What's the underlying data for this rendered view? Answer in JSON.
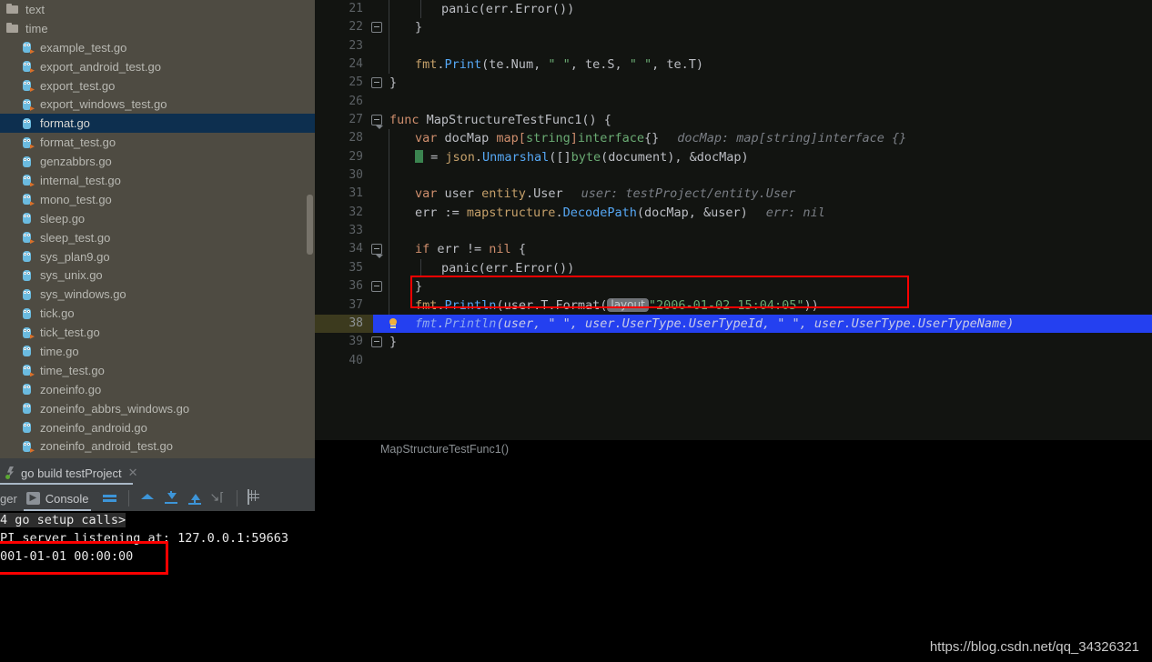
{
  "sidebar": {
    "name": "project-file-tree",
    "items": [
      {
        "label": "text",
        "icon": "folder-icon",
        "kind": "folder",
        "depth": 0,
        "selected": false
      },
      {
        "label": "time",
        "icon": "folder-icon",
        "kind": "folder",
        "depth": 0,
        "selected": false
      },
      {
        "label": "example_test.go",
        "icon": "go-test-file-icon",
        "kind": "gotest",
        "depth": 1,
        "selected": false
      },
      {
        "label": "export_android_test.go",
        "icon": "go-test-file-icon",
        "kind": "gotest",
        "depth": 1,
        "selected": false
      },
      {
        "label": "export_test.go",
        "icon": "go-test-file-icon",
        "kind": "gotest",
        "depth": 1,
        "selected": false
      },
      {
        "label": "export_windows_test.go",
        "icon": "go-test-file-icon",
        "kind": "gotest",
        "depth": 1,
        "selected": false
      },
      {
        "label": "format.go",
        "icon": "go-file-icon",
        "kind": "go",
        "depth": 1,
        "selected": true
      },
      {
        "label": "format_test.go",
        "icon": "go-test-file-icon",
        "kind": "gotest",
        "depth": 1,
        "selected": false
      },
      {
        "label": "genzabbrs.go",
        "icon": "go-file-icon",
        "kind": "go",
        "depth": 1,
        "selected": false
      },
      {
        "label": "internal_test.go",
        "icon": "go-test-file-icon",
        "kind": "gotest",
        "depth": 1,
        "selected": false
      },
      {
        "label": "mono_test.go",
        "icon": "go-test-file-icon",
        "kind": "gotest",
        "depth": 1,
        "selected": false
      },
      {
        "label": "sleep.go",
        "icon": "go-file-icon",
        "kind": "go",
        "depth": 1,
        "selected": false
      },
      {
        "label": "sleep_test.go",
        "icon": "go-test-file-icon",
        "kind": "gotest",
        "depth": 1,
        "selected": false
      },
      {
        "label": "sys_plan9.go",
        "icon": "go-file-icon",
        "kind": "go",
        "depth": 1,
        "selected": false
      },
      {
        "label": "sys_unix.go",
        "icon": "go-file-icon",
        "kind": "go",
        "depth": 1,
        "selected": false
      },
      {
        "label": "sys_windows.go",
        "icon": "go-file-icon",
        "kind": "go",
        "depth": 1,
        "selected": false
      },
      {
        "label": "tick.go",
        "icon": "go-file-icon",
        "kind": "go",
        "depth": 1,
        "selected": false
      },
      {
        "label": "tick_test.go",
        "icon": "go-test-file-icon",
        "kind": "gotest",
        "depth": 1,
        "selected": false
      },
      {
        "label": "time.go",
        "icon": "go-file-icon",
        "kind": "go",
        "depth": 1,
        "selected": false
      },
      {
        "label": "time_test.go",
        "icon": "go-test-file-icon",
        "kind": "gotest",
        "depth": 1,
        "selected": false
      },
      {
        "label": "zoneinfo.go",
        "icon": "go-file-icon",
        "kind": "go",
        "depth": 1,
        "selected": false
      },
      {
        "label": "zoneinfo_abbrs_windows.go",
        "icon": "go-file-icon",
        "kind": "go",
        "depth": 1,
        "selected": false
      },
      {
        "label": "zoneinfo_android.go",
        "icon": "go-file-icon",
        "kind": "go",
        "depth": 1,
        "selected": false
      },
      {
        "label": "zoneinfo_android_test.go",
        "icon": "go-test-file-icon",
        "kind": "gotest",
        "depth": 1,
        "selected": false
      }
    ]
  },
  "editor": {
    "name": "code-editor",
    "language": "go",
    "first_line": 21,
    "selected_line": 38,
    "breakpoint_line": 38,
    "lines": [
      {
        "n": "21"
      },
      {
        "n": "22"
      },
      {
        "n": "23"
      },
      {
        "n": "24"
      },
      {
        "n": "25"
      },
      {
        "n": "26"
      },
      {
        "n": "27"
      },
      {
        "n": "28"
      },
      {
        "n": "29"
      },
      {
        "n": "30"
      },
      {
        "n": "31"
      },
      {
        "n": "32"
      },
      {
        "n": "33"
      },
      {
        "n": "34"
      },
      {
        "n": "35"
      },
      {
        "n": "36"
      },
      {
        "n": "37"
      },
      {
        "n": "38"
      },
      {
        "n": "39"
      },
      {
        "n": "40"
      }
    ],
    "code": {
      "l21_panic": "panic(err.Error())",
      "l22_brace": "}",
      "l24_fmt_pkg": "fmt",
      "l24_dot": ".",
      "l24_fn": "Print",
      "l24_args": "(te.Num, ",
      "l24_s1": "\" \"",
      "l24_m1": ", te.S, ",
      "l24_s2": "\" \"",
      "l24_m2": ", te.T)",
      "l25_brace": "}",
      "l27_kw": "func",
      "l27_name": " MapStructureTestFunc1() {",
      "l28_kw": "var",
      "l28_varname": " docMap ",
      "l28_maptype": "map[",
      "l28_string": "string",
      "l28_rb": "]",
      "l28_iface": "interface",
      "l28_braces": "{}",
      "l28_hint": "docMap: map[string]interface {}",
      "l29_assign": " = ",
      "l29_pkg": "json",
      "l29_dot": ".",
      "l29_fn": "Unmarshal",
      "l29_a1": "([]",
      "l29_byte": "byte",
      "l29_a2": "(document), &docMap)",
      "l31_kw": "var",
      "l31_name": " user ",
      "l31_pkg": "entity",
      "l31_dot": ".",
      "l31_type": "User",
      "l31_hint": "user: testProject/entity.User",
      "l32_name": "err := ",
      "l32_pkg": "mapstructure",
      "l32_dot": ".",
      "l32_fn": "DecodePath",
      "l32_args": "(docMap, &user)",
      "l32_hint": "err: nil",
      "l34_kw": "if",
      "l34_expr": " err != ",
      "l34_nil": "nil",
      "l34_brace": " {",
      "l35_panic": "panic(err.Error())",
      "l36_brace": "}",
      "l37_pkg": "fmt",
      "l37_dot": ".",
      "l37_fn": "Println",
      "l37_a1": "(user.T.Format(",
      "l37_param_hint": "layout",
      "l37_str": "\"2006-01-02 15:04:05\"",
      "l37_a2": "))",
      "l38_pkg": "fmt",
      "l38_dot": ".",
      "l38_fn": "Println",
      "l38_rest": "(user, \" \", user.UserType.UserTypeId, \" \", user.UserType.UserTypeName)",
      "l39_brace": "}"
    },
    "breadcrumb": "MapStructureTestFunc1()"
  },
  "toolwindow": {
    "name": "run-tool-window",
    "run_tab_label": "go build testProject",
    "run_tab_icon": "go-run-config-icon",
    "close_icon": "close-icon",
    "left_tab_label": "ger",
    "console_tab_label": "Console",
    "console_tab_icon": "console-icon",
    "buttons": [
      {
        "name": "soft-wrap-button",
        "icon": "wrap-lines-icon"
      },
      {
        "name": "scroll-to-top-button",
        "icon": "up-to-stack-icon"
      },
      {
        "name": "scroll-to-end-button",
        "icon": "arrow-down-to-line-icon"
      },
      {
        "name": "scroll-to-start-button",
        "icon": "arrow-up-to-line-icon"
      },
      {
        "name": "soft-wrap-toggle",
        "icon": "soft-wrap-icon"
      },
      {
        "name": "print-button",
        "icon": "grid-icon"
      }
    ]
  },
  "console": {
    "name": "console-output",
    "lines": [
      {
        "text": "4 go setup calls>",
        "highlight": true
      },
      {
        "text": "PI server listening at: 127.0.0.1:59663",
        "highlight": false
      },
      {
        "text": "001-01-01 00:00:00",
        "highlight": false
      }
    ]
  },
  "annotations": {
    "editor_box_label": "red-highlight-box-lines-36-37",
    "console_box_label": "red-highlight-box-datetime"
  },
  "watermark": {
    "text": "https://blog.csdn.net/qq_34326321"
  },
  "colors": {
    "sidebar_bg": "#4e4b42",
    "sidebar_selected": "#0d2f4f",
    "editor_bg": "#121411",
    "selection_blue": "#2440f0",
    "breakpoint_red": "#d0625a",
    "annotation_red": "#ff0000",
    "toolwindow_bg": "#3c3f41",
    "console_bg": "#000000",
    "accent_blue": "#3d95d8"
  }
}
